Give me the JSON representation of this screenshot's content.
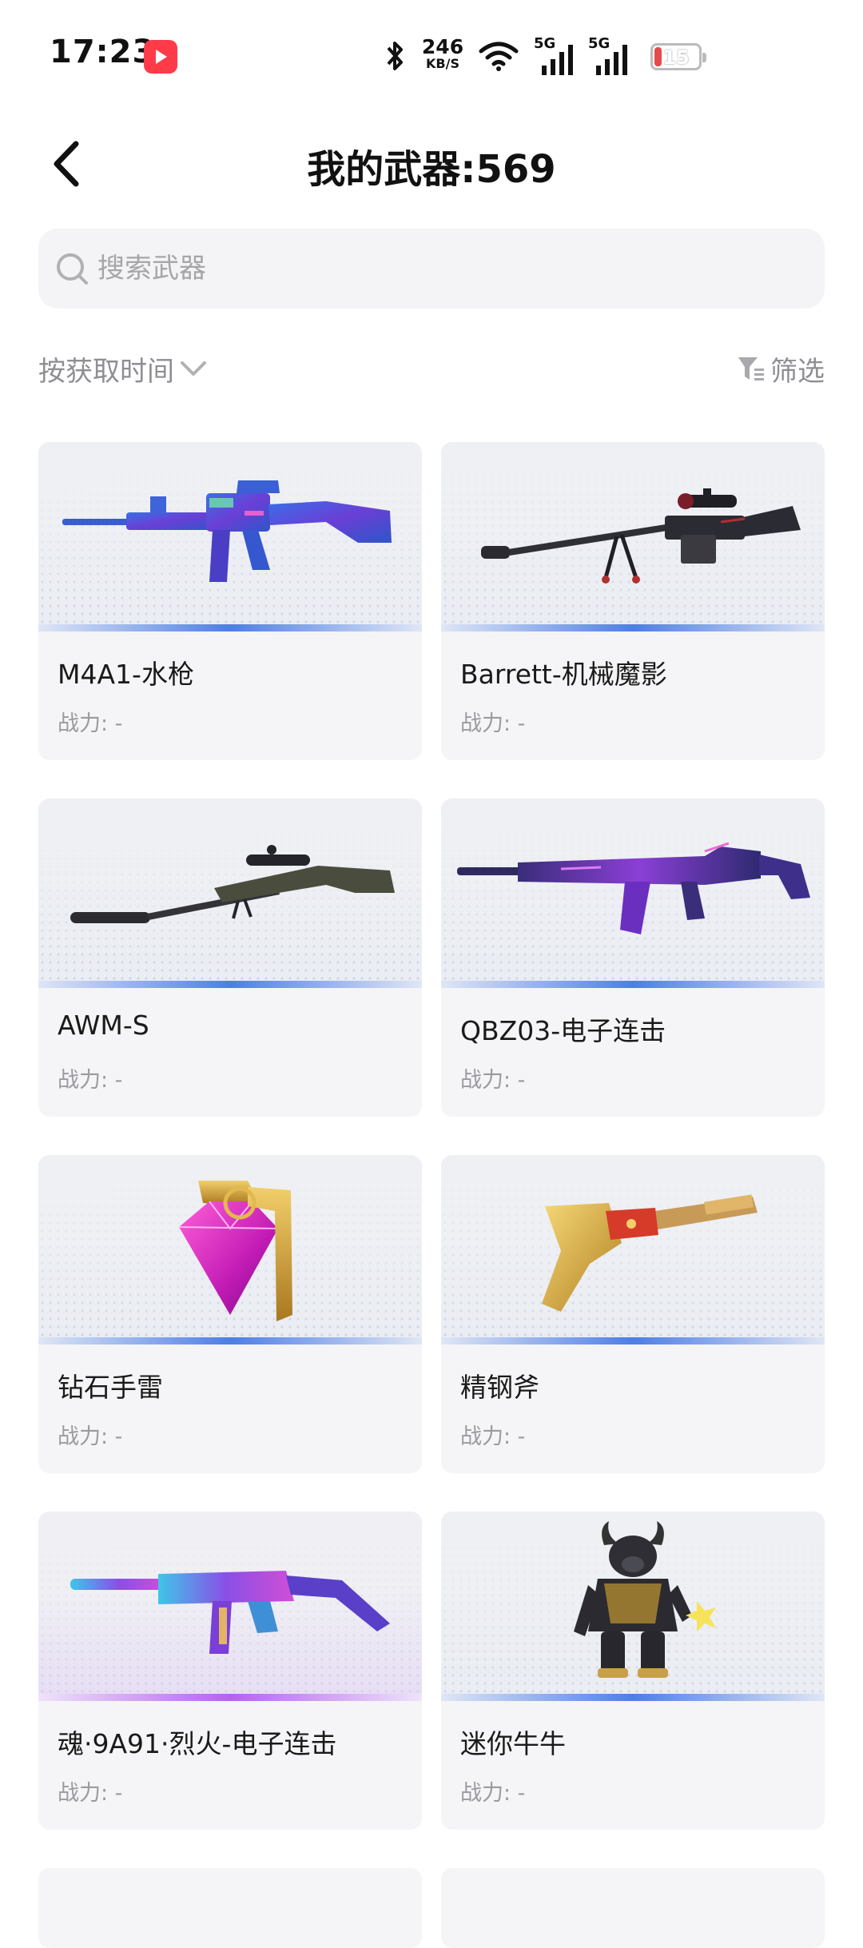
{
  "status_bar": {
    "time": "17:23",
    "app_icon": "red-play-icon",
    "net_speed_value": "246",
    "net_speed_unit": "KB/S",
    "network_1": "5G",
    "network_2": "5G",
    "battery_level": "15",
    "icons": [
      "bluetooth-icon",
      "wifi-icon",
      "signal-icon",
      "signal-icon",
      "battery-icon"
    ]
  },
  "header": {
    "title": "我的武器:569",
    "back_icon": "chevron-left-icon"
  },
  "search": {
    "placeholder": "搜索武器",
    "icon": "search-icon"
  },
  "toolbar": {
    "sort_label": "按获取时间",
    "sort_icon": "chevron-down-icon",
    "filter_label": "筛选",
    "filter_icon": "filter-icon"
  },
  "weapons": [
    {
      "name": "M4A1-水枪",
      "power": "战力: -",
      "icon": "assault-rifle-icon",
      "rarity_color": "#4d7ee6"
    },
    {
      "name": "Barrett-机械魔影",
      "power": "战力: -",
      "icon": "sniper-rifle-icon",
      "rarity_color": "#4d7ee6"
    },
    {
      "name": "AWM-S",
      "power": "战力: -",
      "icon": "sniper-rifle-icon",
      "rarity_color": "#4d7ee6"
    },
    {
      "name": "QBZ03-电子连击",
      "power": "战力: -",
      "icon": "assault-rifle-icon",
      "rarity_color": "#4d7ee6"
    },
    {
      "name": "钻石手雷",
      "power": "战力: -",
      "icon": "diamond-grenade-icon",
      "rarity_color": "#4d7ee6"
    },
    {
      "name": "精钢斧",
      "power": "战力: -",
      "icon": "axe-icon",
      "rarity_color": "#4d7ee6"
    },
    {
      "name": "魂·9A91·烈火-电子连击",
      "power": "战力: -",
      "icon": "smg-icon",
      "rarity_color": "#b661ee"
    },
    {
      "name": "迷你牛牛",
      "power": "战力: -",
      "icon": "bull-character-icon",
      "rarity_color": "#4d7ee6"
    }
  ]
}
